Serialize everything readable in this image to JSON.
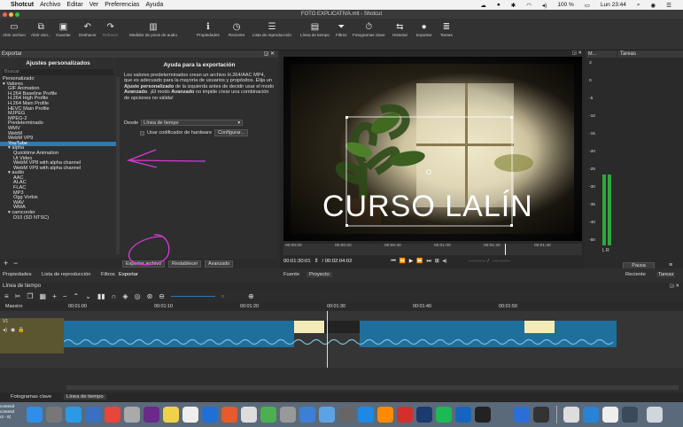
{
  "menubar": {
    "apple": "",
    "app_name": "Shotcut",
    "items": [
      "Archivo",
      "Editar",
      "Ver",
      "Preferencias",
      "Ayuda"
    ],
    "battery": "100 %",
    "clock": "Lun 23:44"
  },
  "window": {
    "title": "FOTO EXPLICATIVA.mlt - Shotcut"
  },
  "toolbar": {
    "buttons": [
      {
        "label": "Abrir archivo",
        "icon": "folder-icon"
      },
      {
        "label": "Abrir otro...",
        "icon": "open-other-icon"
      },
      {
        "label": "Guardar",
        "icon": "save-icon"
      },
      {
        "label": "Deshacer",
        "icon": "undo-icon"
      },
      {
        "label": "Rehacer",
        "icon": "redo-icon"
      },
      {
        "label": "Medidor de picos de audio",
        "icon": "audio-meter-icon"
      },
      {
        "label": "Propiedades",
        "icon": "info-icon"
      },
      {
        "label": "Reciente",
        "icon": "clock-icon"
      },
      {
        "label": "Lista de reproducción",
        "icon": "playlist-icon"
      },
      {
        "label": "Línea de tiempo",
        "icon": "timeline-icon"
      },
      {
        "label": "Filtros",
        "icon": "filter-icon"
      },
      {
        "label": "Fotogramas clave",
        "icon": "keyframes-icon"
      },
      {
        "label": "Historial",
        "icon": "history-icon"
      },
      {
        "label": "Exportar",
        "icon": "export-icon"
      },
      {
        "label": "Tareas",
        "icon": "tasks-icon"
      }
    ]
  },
  "export_panel": {
    "header": "Exportar",
    "presets_title": "Ajustes personalizados",
    "search_placeholder": "Buscar",
    "tree": [
      {
        "label": "Personalizado",
        "level": 0
      },
      {
        "label": "▾ Valores",
        "level": 0
      },
      {
        "label": "GIF Animation",
        "level": 1
      },
      {
        "label": "H.264 Baseline Profile",
        "level": 1
      },
      {
        "label": "H.264 High Profile",
        "level": 1
      },
      {
        "label": "H.264 Main Profile",
        "level": 1
      },
      {
        "label": "HEVC Main Profile",
        "level": 1
      },
      {
        "label": "MJPEG",
        "level": 1
      },
      {
        "label": "MPEG-2",
        "level": 1
      },
      {
        "label": "Predeterminado",
        "level": 1
      },
      {
        "label": "WMV",
        "level": 1
      },
      {
        "label": "WebM",
        "level": 1
      },
      {
        "label": "WebM VP9",
        "level": 1
      },
      {
        "label": "YouTube",
        "level": 1,
        "selected": true
      },
      {
        "label": "▾ alpha",
        "level": 1
      },
      {
        "label": "Quicktime Animation",
        "level": 2
      },
      {
        "label": "Ut Video",
        "level": 2
      },
      {
        "label": "WebM VP8 with alpha channel",
        "level": 2
      },
      {
        "label": "WebM VP9 with alpha channel",
        "level": 2
      },
      {
        "label": "▾ audio",
        "level": 1
      },
      {
        "label": "AAC",
        "level": 2
      },
      {
        "label": "ALAC",
        "level": 2
      },
      {
        "label": "FLAC",
        "level": 2
      },
      {
        "label": "MP3",
        "level": 2
      },
      {
        "label": "Ogg Vorbis",
        "level": 2
      },
      {
        "label": "WAV",
        "level": 2
      },
      {
        "label": "WMA",
        "level": 2
      },
      {
        "label": "▾ camcorder",
        "level": 1
      },
      {
        "label": "D10 (SD NTSC)",
        "level": 2
      }
    ],
    "help_title": "Ayuda para la exportación",
    "help_text_1": "Los valores predeterminados crean un archivo H.264/AAC MP4, que es adecuado para la mayoría de usuarios y propósitos. Elija un ",
    "help_bold_1": "Ajuste personalizado",
    "help_text_2": " de la izquierda antes de decidir usar el modo ",
    "help_bold_2": "Avanzado",
    "help_text_3": ". ¡El modo ",
    "help_bold_3": "Avanzado",
    "help_text_4": " no impide crear una combinación de opciones no válida!",
    "from_label": "Desde",
    "from_value": "Línea de tiempo",
    "hw_label": "Usar codificador de hardware",
    "configure_label": "Configurar...",
    "export_button": "Exportar archivo",
    "reset_button": "Restablecer",
    "advanced_button": "Avanzado"
  },
  "player": {
    "overlay_text": "CURSO LALÍN",
    "ruler_ticks": [
      "00:00:00",
      "00:00:20",
      "00:00:40",
      "00:01:00",
      "00:01:20",
      "00:01:40"
    ],
    "timecode": "00:01:30:01",
    "duration": "/ 00:02:04:02",
    "in_out": "--:--:--:-- /",
    "in_out2": "--:--:--:--",
    "tab_source": "Fuente",
    "tab_project": "Proyecto"
  },
  "meter": {
    "title": "M...",
    "scale": [
      "3",
      "0",
      "-5",
      "-10",
      "-15",
      "-20",
      "-25",
      "-30",
      "-35",
      "-40",
      "-50"
    ],
    "lr": "L R"
  },
  "tasks": {
    "title": "Tareas",
    "pause": "Pausa",
    "recent_tab": "Reciente",
    "tasks_tab": "Tareas"
  },
  "tabs_left": [
    "Propiedades",
    "Lista de reproducción",
    "Filtros",
    "Exportar"
  ],
  "timeline": {
    "title": "Línea de tiempo",
    "master": "Maestro",
    "ruler": [
      "00:01:00",
      "00:01:10",
      "00:01:20",
      "00:01:30",
      "00:01:40",
      "00:01:50"
    ],
    "track_label": "V1"
  },
  "bottom_tabs": [
    "Fotogramas clave",
    "Línea de tiempo"
  ],
  "side_cut_text": [
    "comend",
    "comend",
    "r2 - 0("
  ],
  "colors": {
    "accent": "#2c7bb7",
    "annotation": "#d63ad6",
    "clip": "#1f6f9c"
  }
}
